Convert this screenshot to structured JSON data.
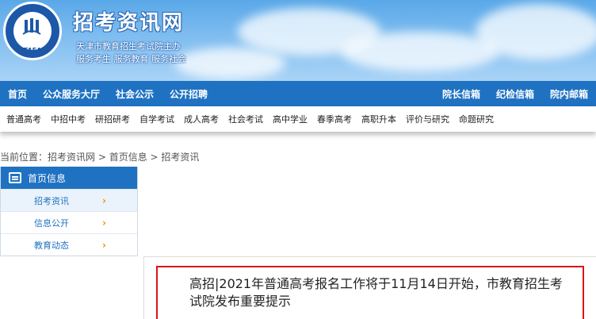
{
  "header": {
    "site_title": "招考资讯网",
    "subtitle_line1": "天津市教育招生考试院主办",
    "subtitle_line2": "服务考生 服务教育 服务社会",
    "logo_text": "TAEA"
  },
  "main_nav": {
    "left": [
      "首页",
      "公众服务大厅",
      "社会公示",
      "公开招聘"
    ],
    "right": [
      "院长信箱",
      "纪检信箱",
      "院内邮箱"
    ]
  },
  "sub_nav": [
    "普通高考",
    "中招中考",
    "研招研考",
    "自学考试",
    "成人高考",
    "社会考试",
    "高中学业",
    "春季高考",
    "高职升本",
    "评价与研究",
    "命题研究"
  ],
  "breadcrumb": {
    "prefix": "当前位置：",
    "items": [
      "招考资讯网",
      "首页信息",
      "招考资讯"
    ],
    "separator": " > "
  },
  "sidebar": {
    "title": "首页信息",
    "items": [
      {
        "label": "招考资讯",
        "arrow": "›"
      },
      {
        "label": "信息公开",
        "arrow": "›"
      },
      {
        "label": "教育动态",
        "arrow": "›"
      }
    ]
  },
  "article": {
    "title": "高招|2021年普通高考报名工作将于11月14日开始，市教育招生考试院发布重要提示"
  },
  "icons": {
    "logo": "taea-logo",
    "sidebar_head": "list-icon"
  },
  "colors": {
    "primary_blue": "#1f72c2",
    "headline_border": "#d9141c",
    "arrow": "#f08c00"
  }
}
